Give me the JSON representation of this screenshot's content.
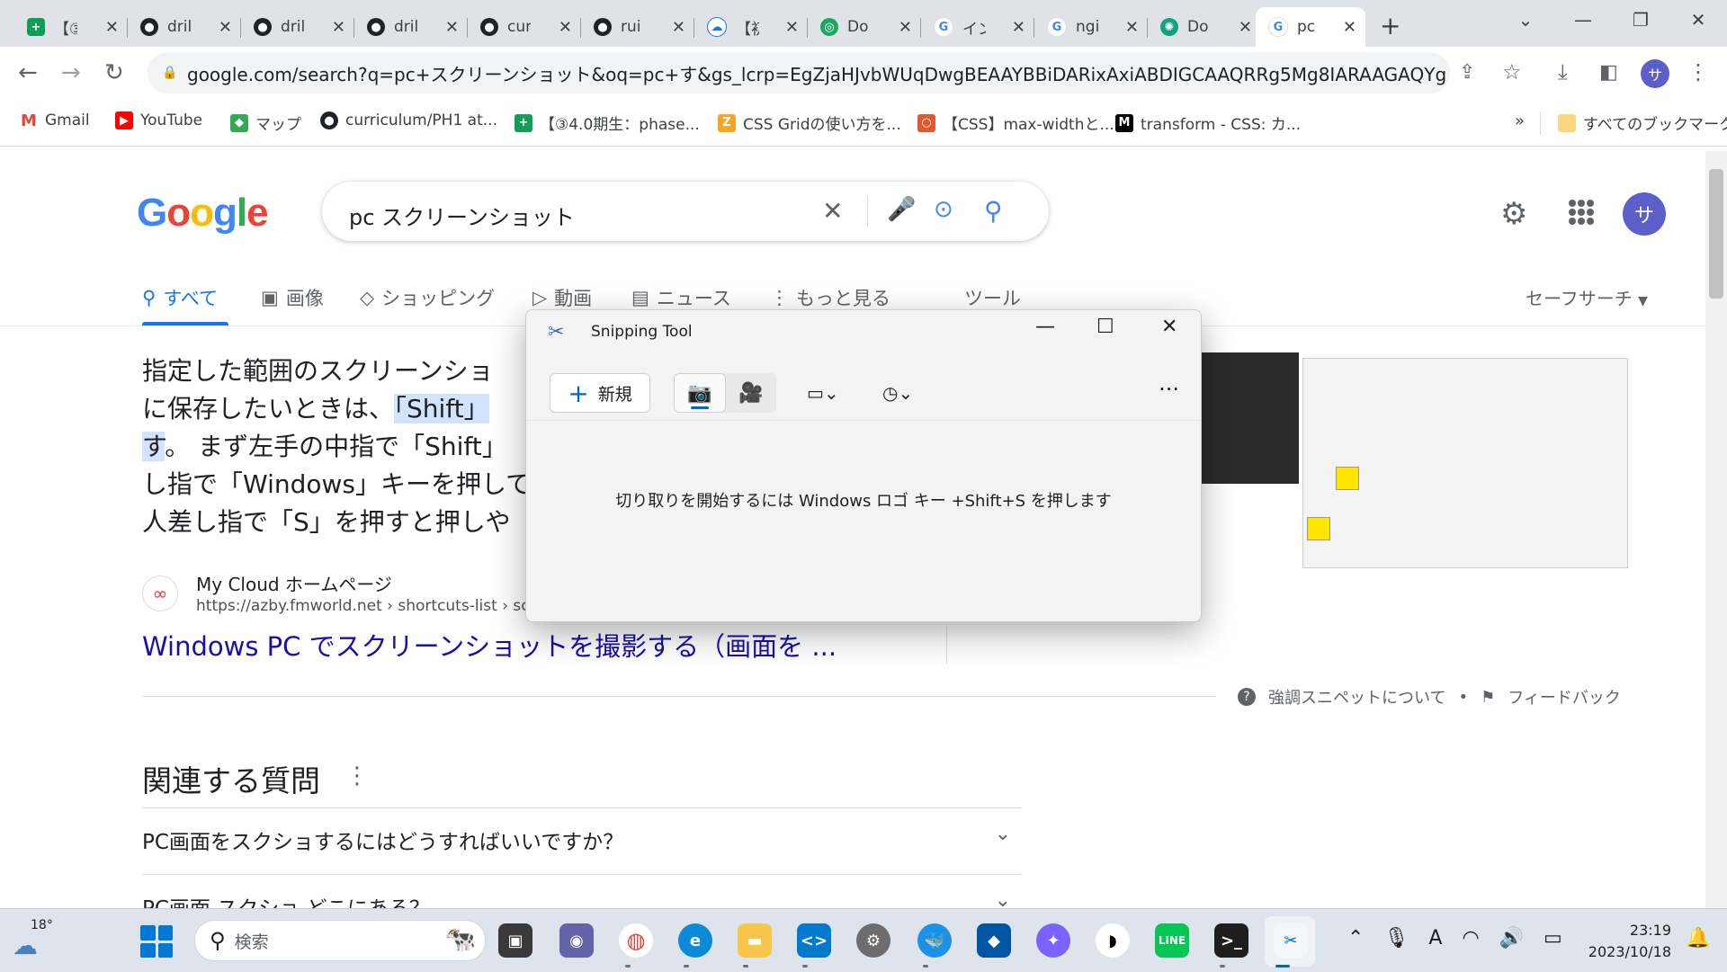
{
  "browser": {
    "tabs": [
      {
        "title": "【③",
        "icon": "sheets-icon"
      },
      {
        "title": "dril",
        "icon": "github-icon"
      },
      {
        "title": "dril",
        "icon": "github-icon"
      },
      {
        "title": "dril",
        "icon": "github-icon"
      },
      {
        "title": "cur",
        "icon": "github-icon"
      },
      {
        "title": "rui",
        "icon": "github-icon"
      },
      {
        "title": "【初",
        "icon": "cloud-icon"
      },
      {
        "title": "Do",
        "icon": "docs-icon"
      },
      {
        "title": "イン",
        "icon": "google-icon"
      },
      {
        "title": "ngi",
        "icon": "google-icon"
      },
      {
        "title": "Do",
        "icon": "chatgpt-icon"
      },
      {
        "title": "pc",
        "icon": "google-icon"
      }
    ],
    "url": "google.com/search?q=pc+スクリーンショット&oq=pc+す&gs_lcrp=EgZjaHJvbWUqDwgBEAAYBBiDARixAxiABDIGCAAQRRg5Mg8IARAAGAQYgwEYsQMY...",
    "profile_initial": "サ",
    "bookmarks": [
      {
        "label": "Gmail"
      },
      {
        "label": "YouTube"
      },
      {
        "label": "マップ"
      },
      {
        "label": "curriculum/PH1 at..."
      },
      {
        "label": "【③4.0期生：phase..."
      },
      {
        "label": "CSS Gridの使い方を..."
      },
      {
        "label": "【CSS】max-widthと..."
      },
      {
        "label": "transform - CSS: カ..."
      }
    ],
    "bookmarks_overflow": "»",
    "all_bookmarks": "すべてのブックマーク"
  },
  "google": {
    "logo": "Google",
    "query": "pc スクリーンショット",
    "avatar_initial": "サ",
    "tabs": [
      {
        "label": "すべて"
      },
      {
        "label": "画像"
      },
      {
        "label": "ショッピング"
      },
      {
        "label": "動画"
      },
      {
        "label": "ニュース"
      },
      {
        "label": "もっと見る"
      }
    ],
    "tools": "ツール",
    "safesearch": "セーフサーチ",
    "snippet": {
      "line1": "指定した範囲のスクリーンショ",
      "line2a": "に保存したいときは、",
      "line2b": "「Shift」",
      "line3a": "す",
      "line3b": "。 まず左手の中指で「Shift」",
      "line4": "し指で「Windows」キーを押して",
      "line5": "人差し指で「S」を押すと押しや"
    },
    "source_name": "My Cloud ホームページ",
    "source_url": "https://azby.fmworld.net › shortcuts-list › scree",
    "result_title": "Windows PC でスクリーンショットを撮影する（画面を ...",
    "about_snippet": "強調スニペットについて",
    "bullet": "•",
    "feedback": "フィードバック",
    "paa_title": "関連する質問",
    "paa": [
      {
        "q": "PC画面をスクショするにはどうすればいいですか？"
      },
      {
        "q": "PC画面 スクショ どこにある？"
      }
    ]
  },
  "snipping_tool": {
    "title": "Snipping Tool",
    "new_button": "新規",
    "message": "切り取りを開始するには Windows ロゴ キー +Shift+S を押します"
  },
  "taskbar": {
    "temperature": "18°",
    "search_placeholder": "検索",
    "time": "23:19",
    "date": "2023/10/18",
    "ime": "A"
  }
}
